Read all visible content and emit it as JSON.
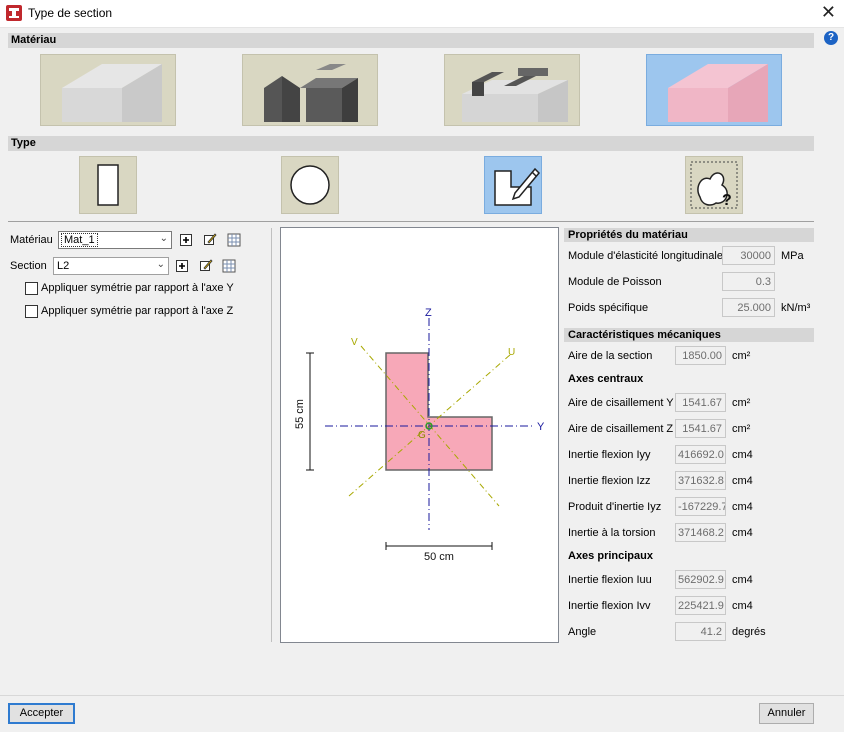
{
  "window": {
    "title": "Type de section",
    "close_glyph": "✕",
    "help_glyph": "?"
  },
  "sections": {
    "material": "Matériau",
    "type": "Type"
  },
  "materials": [
    {
      "name": "concrete-block-icon",
      "selected": false
    },
    {
      "name": "steel-profile-icon",
      "selected": false
    },
    {
      "name": "mixed-profile-icon",
      "selected": false
    },
    {
      "name": "generic-material-icon",
      "selected": true
    }
  ],
  "types": [
    {
      "name": "rectangle-section-icon",
      "selected": false
    },
    {
      "name": "circle-section-icon",
      "selected": false
    },
    {
      "name": "polygon-edit-section-icon",
      "selected": true
    },
    {
      "name": "unknown-section-icon",
      "selected": false
    }
  ],
  "left": {
    "material_label": "Matériau",
    "material_value": "Mat_1",
    "section_label": "Section",
    "section_value": "L2",
    "sym_y_label": "Appliquer symétrie par rapport à l'axe Y",
    "sym_z_label": "Appliquer symétrie par rapport à l'axe Z",
    "sym_y_checked": false,
    "sym_z_checked": false
  },
  "drawing": {
    "axis_z": "Z",
    "axis_y": "Y",
    "axis_v": "V",
    "axis_u": "U",
    "centroid_label": "G",
    "dim_height": "55 cm",
    "dim_width": "50 cm",
    "section_fill": "#f7a8b8"
  },
  "material_properties": {
    "header": "Propriétés du matériau",
    "elastic_modulus_label": "Module d'élasticité longitudinale",
    "elastic_modulus_value": "30000",
    "elastic_modulus_unit": "MPa",
    "poisson_label": "Module de Poisson",
    "poisson_value": "0.3",
    "specific_weight_label": "Poids spécifique",
    "specific_weight_value": "25.000",
    "specific_weight_unit": "kN/m³"
  },
  "mechanical": {
    "header": "Caractéristiques mécaniques",
    "area_label": "Aire de la section",
    "area_value": "1850.00",
    "area_unit": "cm²",
    "central_axes_header": "Axes centraux",
    "shear_y_label": "Aire de cisaillement Y",
    "shear_y_value": "1541.67",
    "shear_y_unit": "cm²",
    "shear_z_label": "Aire de cisaillement Z",
    "shear_z_value": "1541.67",
    "shear_z_unit": "cm²",
    "iyy_label": "Inertie flexion Iyy",
    "iyy_value": "416692.0",
    "iyy_unit": "cm4",
    "izz_label": "Inertie flexion Izz",
    "izz_value": "371632.8",
    "izz_unit": "cm4",
    "iyz_label": "Produit d'inertie Iyz",
    "iyz_value": "-167229.7",
    "iyz_unit": "cm4",
    "torsion_label": "Inertie à la torsion",
    "torsion_value": "371468.2",
    "torsion_unit": "cm4",
    "principal_axes_header": "Axes principaux",
    "iuu_label": "Inertie flexion Iuu",
    "iuu_value": "562902.9",
    "iuu_unit": "cm4",
    "ivv_label": "Inertie flexion Ivv",
    "ivv_value": "225421.9",
    "ivv_unit": "cm4",
    "angle_label": "Angle",
    "angle_value": "41.2",
    "angle_unit": "degrés"
  },
  "footer": {
    "accept_label": "Accepter",
    "cancel_label": "Annuler"
  },
  "colors": {
    "accent_selected": "#9dc6ee",
    "button_bg": "#d9d7c2",
    "axis_color": "#1a1a9e",
    "principal_axis_color": "#a8a800"
  }
}
